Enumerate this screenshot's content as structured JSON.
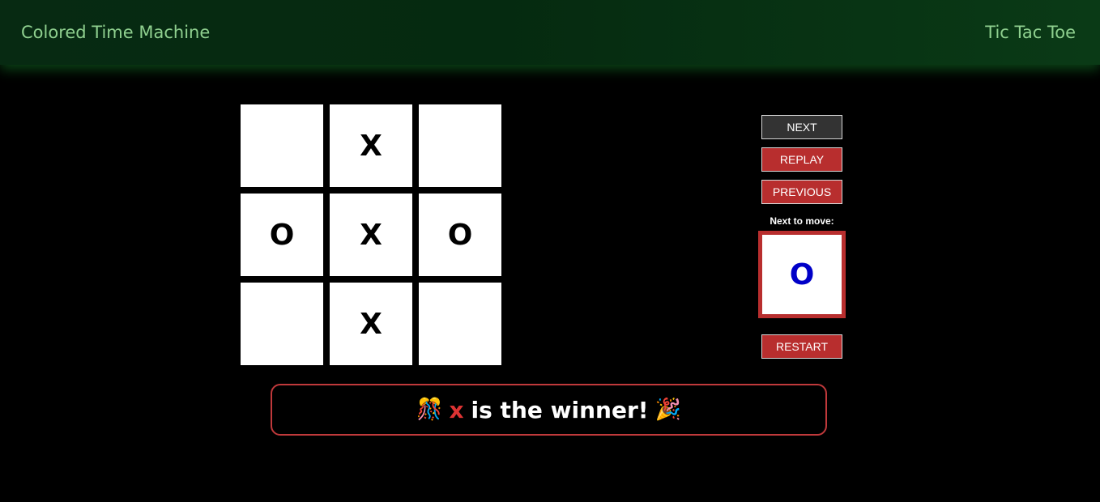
{
  "header": {
    "brand": "Colored Time Machine",
    "title": "Tic Tac Toe"
  },
  "board": {
    "cells": [
      "",
      "X",
      "",
      "O",
      "X",
      "O",
      "",
      "X",
      ""
    ]
  },
  "controls": {
    "next_label": "NEXT",
    "replay_label": "REPLAY",
    "previous_label": "PREVIOUS",
    "next_to_move_label": "Next to move:",
    "next_to_move_value": "O",
    "restart_label": "RESTART"
  },
  "result": {
    "player": "x",
    "message": "is the winner!",
    "icon_left": "🎊",
    "icon_right": "🎉"
  },
  "colors": {
    "header_text": "#8fd08f",
    "accent_red": "#b82e2e",
    "next_player_blue": "#0000c8",
    "winner_player_red": "#dd3333"
  }
}
